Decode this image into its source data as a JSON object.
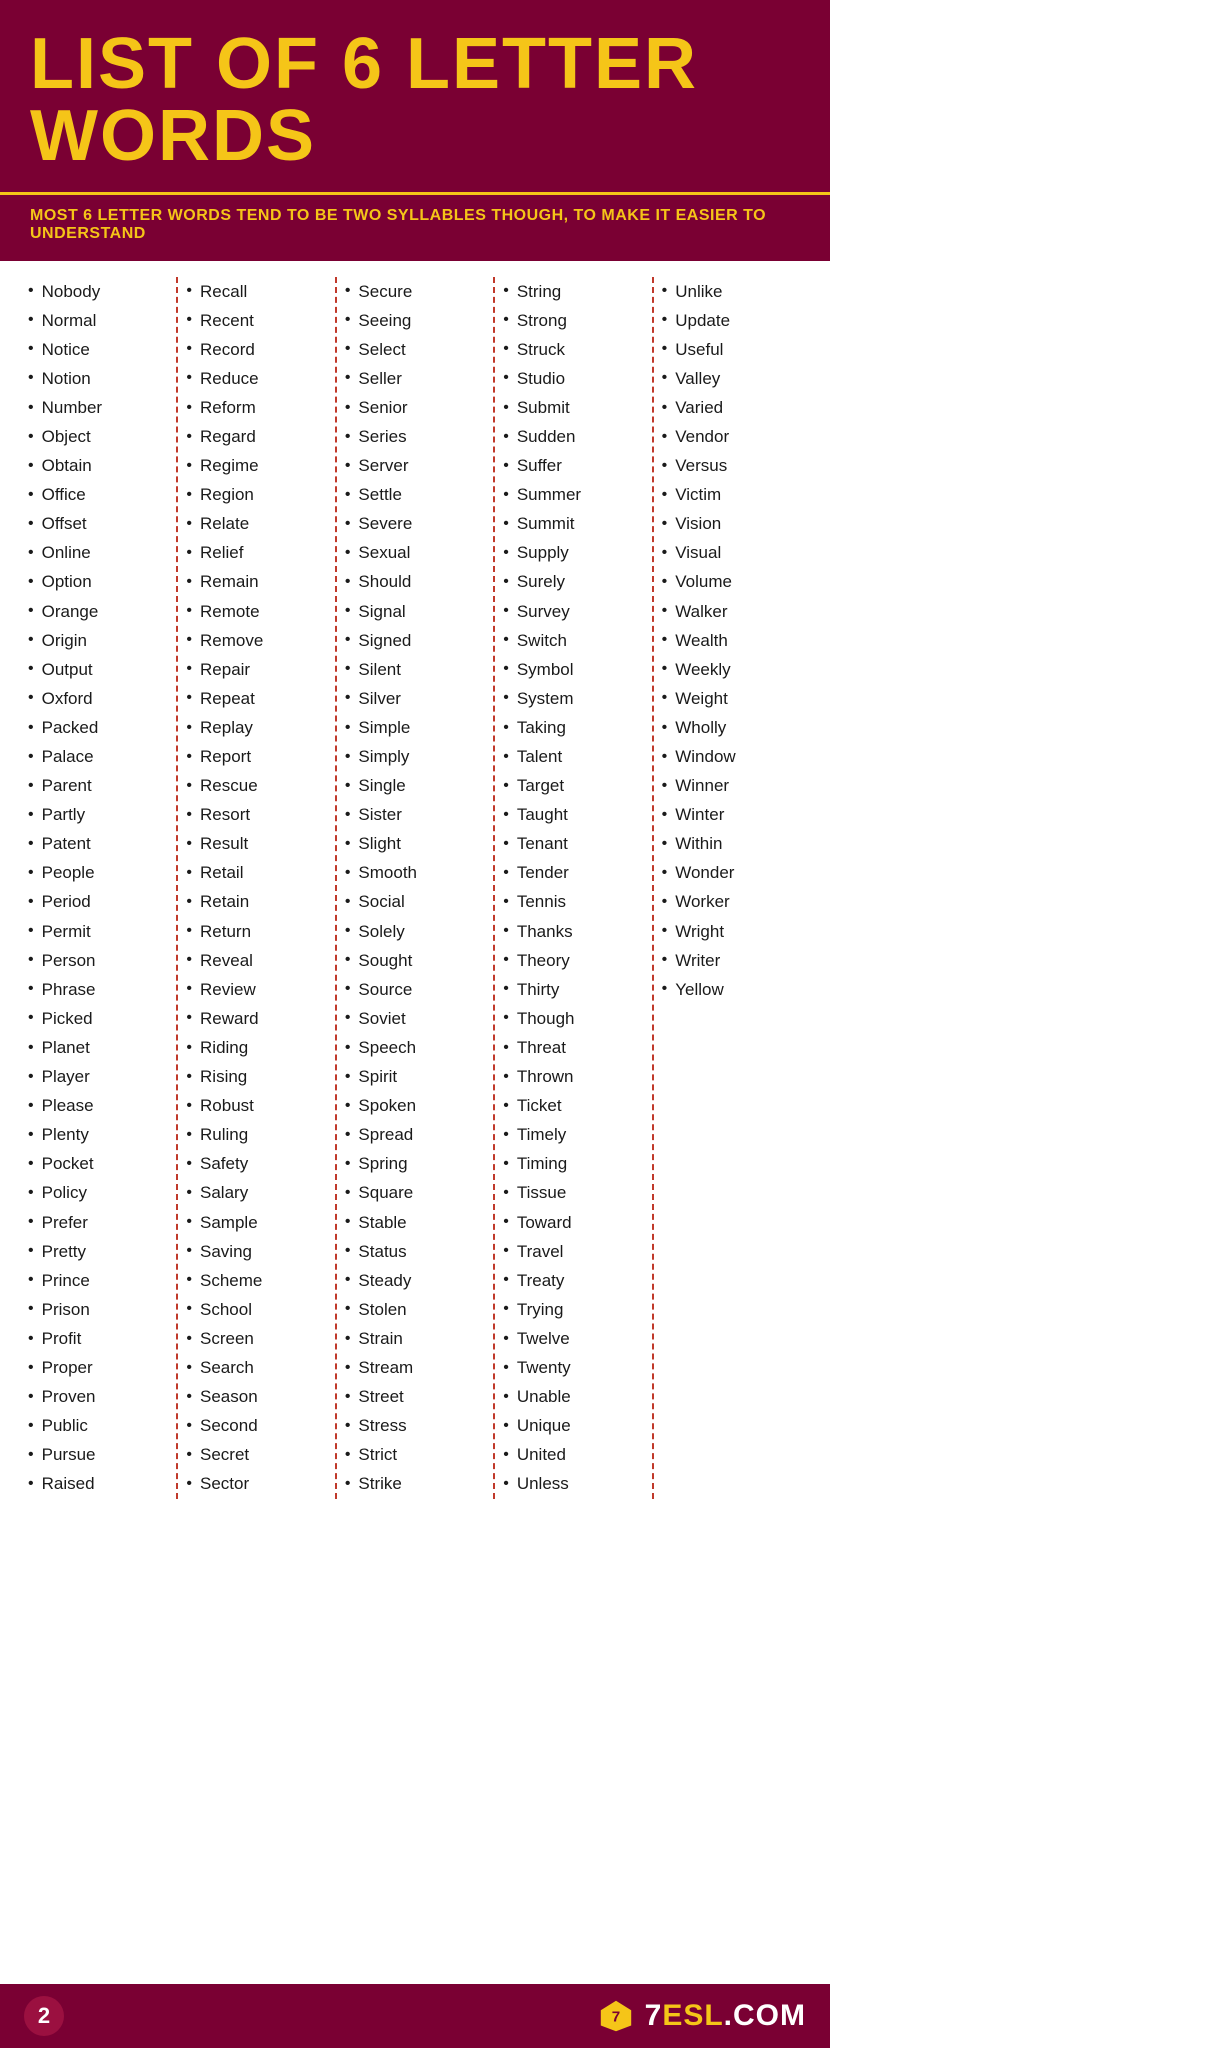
{
  "header": {
    "title": "LIST OF 6 LETTER WORDS"
  },
  "subtitle": {
    "text": "MOST 6 LETTER WORDS TEND TO BE TWO SYLLABLES THOUGH, TO MAKE IT EASIER TO UNDERSTAND"
  },
  "columns": [
    {
      "id": "col1",
      "words": [
        "Nobody",
        "Normal",
        "Notice",
        "Notion",
        "Number",
        "Object",
        "Obtain",
        "Office",
        "Offset",
        "Online",
        "Option",
        "Orange",
        "Origin",
        "Output",
        "Oxford",
        "Packed",
        "Palace",
        "Parent",
        "Partly",
        "Patent",
        "People",
        "Period",
        "Permit",
        "Person",
        "Phrase",
        "Picked",
        "Planet",
        "Player",
        "Please",
        "Plenty",
        "Pocket",
        "Policy",
        "Prefer",
        "Pretty",
        "Prince",
        "Prison",
        "Profit",
        "Proper",
        "Proven",
        "Public",
        "Pursue",
        "Raised"
      ]
    },
    {
      "id": "col2",
      "words": [
        "Recall",
        "Recent",
        "Record",
        "Reduce",
        "Reform",
        "Regard",
        "Regime",
        "Region",
        "Relate",
        "Relief",
        "Remain",
        "Remote",
        "Remove",
        "Repair",
        "Repeat",
        "Replay",
        "Report",
        "Rescue",
        "Resort",
        "Result",
        "Retail",
        "Retain",
        "Return",
        "Reveal",
        "Review",
        "Reward",
        "Riding",
        "Rising",
        "Robust",
        "Ruling",
        "Safety",
        "Salary",
        "Sample",
        "Saving",
        "Scheme",
        "School",
        "Screen",
        "Search",
        "Season",
        "Second",
        "Secret",
        "Sector"
      ]
    },
    {
      "id": "col3",
      "words": [
        "Secure",
        "Seeing",
        "Select",
        "Seller",
        "Senior",
        "Series",
        "Server",
        "Settle",
        "Severe",
        "Sexual",
        "Should",
        "Signal",
        "Signed",
        "Silent",
        "Silver",
        "Simple",
        "Simply",
        "Single",
        "Sister",
        "Slight",
        "Smooth",
        "Social",
        "Solely",
        "Sought",
        "Source",
        "Soviet",
        "Speech",
        "Spirit",
        "Spoken",
        "Spread",
        "Spring",
        "Square",
        "Stable",
        "Status",
        "Steady",
        "Stolen",
        "Strain",
        "Stream",
        "Street",
        "Stress",
        "Strict",
        "Strike"
      ]
    },
    {
      "id": "col4",
      "words": [
        "String",
        "Strong",
        "Struck",
        "Studio",
        "Submit",
        "Sudden",
        "Suffer",
        "Summer",
        "Summit",
        "Supply",
        "Surely",
        "Survey",
        "Switch",
        "Symbol",
        "System",
        "Taking",
        "Talent",
        "Target",
        "Taught",
        "Tenant",
        "Tender",
        "Tennis",
        "Thanks",
        "Theory",
        "Thirty",
        "Though",
        "Threat",
        "Thrown",
        "Ticket",
        "Timely",
        "Timing",
        "Tissue",
        "Toward",
        "Travel",
        "Treaty",
        "Trying",
        "Twelve",
        "Twenty",
        "Unable",
        "Unique",
        "United",
        "Unless"
      ]
    },
    {
      "id": "col5",
      "words": [
        "Unlike",
        "Update",
        "Useful",
        "Valley",
        "Varied",
        "Vendor",
        "Versus",
        "Victim",
        "Vision",
        "Visual",
        "Volume",
        "Walker",
        "Wealth",
        "Weekly",
        "Weight",
        "Wholly",
        "Window",
        "Winner",
        "Winter",
        "Within",
        "Wonder",
        "Worker",
        "Wright",
        "Writer",
        "Yellow"
      ]
    }
  ],
  "footer": {
    "page_number": "2",
    "logo_text": "7ESL.COM"
  },
  "watermark": {
    "text": "7ESL.COM"
  }
}
